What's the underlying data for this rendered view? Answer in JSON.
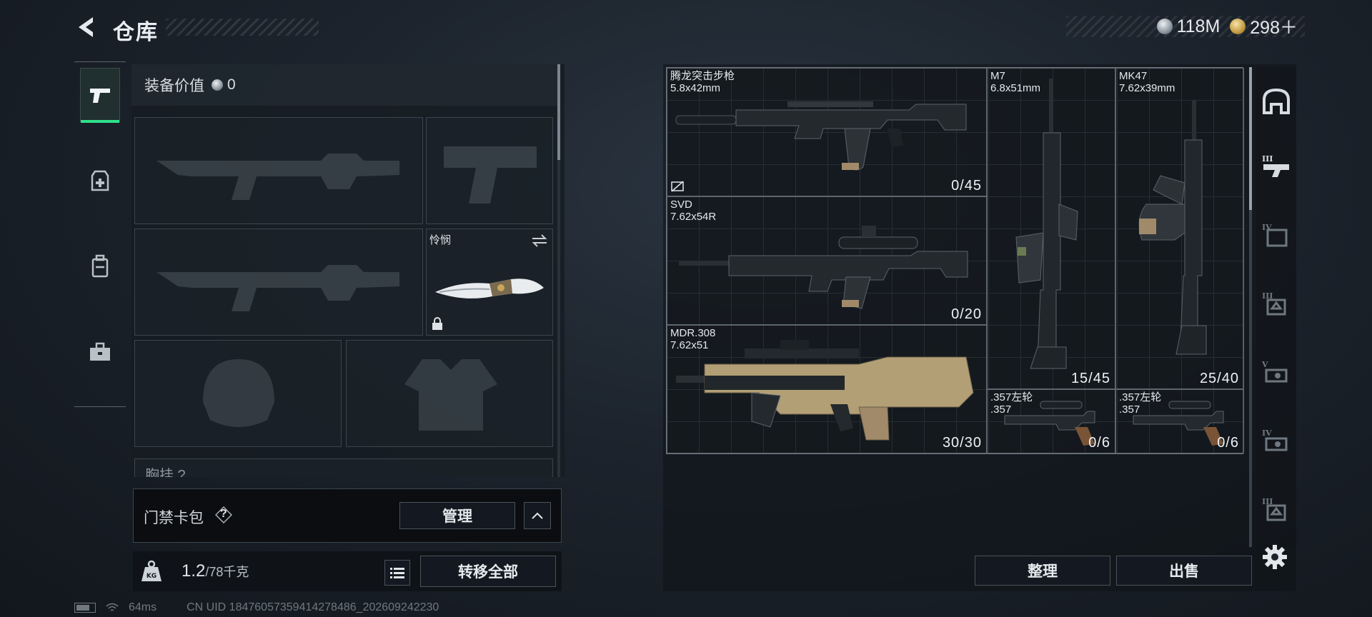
{
  "header": {
    "title": "仓库"
  },
  "currency": [
    {
      "icon": "silver-coin-icon",
      "value": "118M"
    },
    {
      "icon": "gold-coin-icon",
      "value": "298＋"
    }
  ],
  "left_categories": [
    {
      "icon": "pistol-icon",
      "active": true
    },
    {
      "icon": "medkit-icon",
      "active": false
    },
    {
      "icon": "backpack-icon",
      "active": false
    },
    {
      "icon": "toolbox-icon",
      "active": false
    }
  ],
  "loadout": {
    "equip_value_label": "装备价值",
    "equip_value": "0",
    "melee_name": "怜悯",
    "chest_label": "胸挂 ?"
  },
  "card_bag": {
    "label": "门禁卡包",
    "help": "?",
    "manage_label": "管理"
  },
  "weight": {
    "current": "1.2",
    "capacity": "/78千克",
    "icon": "kg-weight-icon"
  },
  "actions": {
    "transfer_all": "转移全部",
    "sort": "整理",
    "sell": "出售"
  },
  "status": {
    "ping": "64ms",
    "uid": "CN UID 18476057359414278486_202609242230"
  },
  "storage_items": [
    {
      "name": "腾龙突击步枪",
      "caliber": "5.8x42mm",
      "ammo": "0/45"
    },
    {
      "name": "M7",
      "caliber": "6.8x51mm",
      "ammo": "15/45"
    },
    {
      "name": "MK47",
      "caliber": "7.62x39mm",
      "ammo": "25/40"
    },
    {
      "name": "SVD",
      "caliber": "7.62x54R",
      "ammo": "0/20"
    },
    {
      "name": "MDR.308",
      "caliber": "7.62x51",
      "ammo": "30/30"
    },
    {
      "name": ".357左轮",
      "caliber": ".357",
      "ammo": "0/6"
    },
    {
      "name": ".357左轮",
      "caliber": ".357",
      "ammo": "0/6"
    }
  ],
  "right_categories": [
    {
      "icon": "helmet-icon",
      "tier": ""
    },
    {
      "icon": "armor-rig-icon",
      "tier": "III"
    },
    {
      "icon": "backpack-tier-icon",
      "tier": "IV"
    },
    {
      "icon": "armor-tier-icon",
      "tier": "III"
    },
    {
      "icon": "chest-rig-icon",
      "tier": "V"
    },
    {
      "icon": "chest-rig-icon",
      "tier": "IV"
    },
    {
      "icon": "armor-tier-icon",
      "tier": "III"
    }
  ]
}
